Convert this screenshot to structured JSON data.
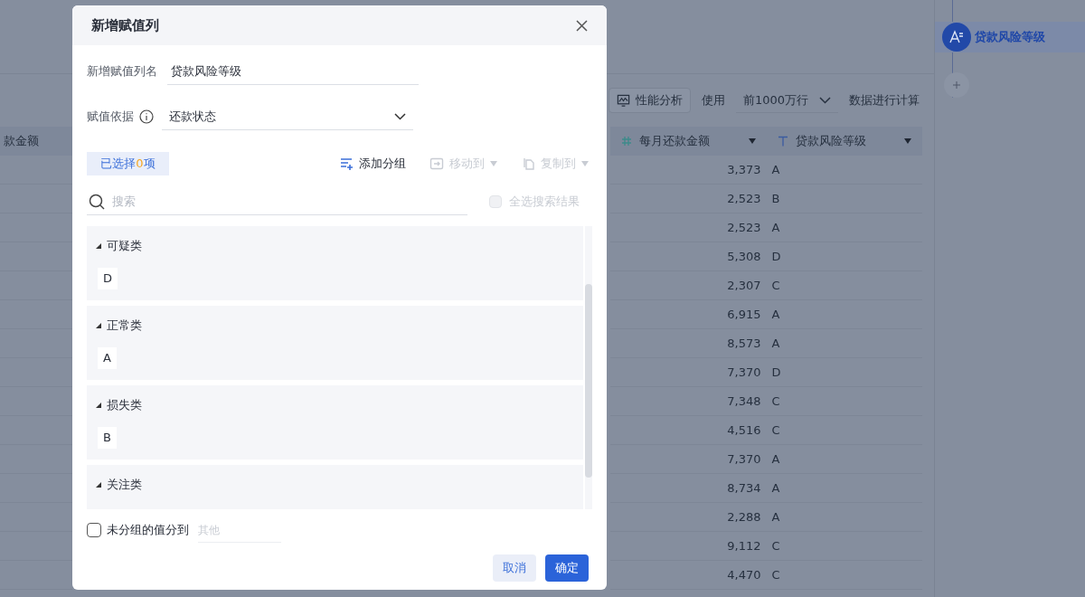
{
  "background": {
    "toolbar": {
      "analysis_button": "性能分析",
      "use_label": "使用",
      "rows_select": "前1000万行",
      "compute_label": "数据进行计算"
    },
    "table": {
      "left_column": "款金额",
      "columns": [
        {
          "label": "每月还款金额",
          "kind": "number"
        },
        {
          "label": "贷款风险等级",
          "kind": "text"
        }
      ],
      "rows": [
        [
          "3,373",
          "A"
        ],
        [
          "2,523",
          "B"
        ],
        [
          "2,523",
          "A"
        ],
        [
          "5,308",
          "D"
        ],
        [
          "2,307",
          "C"
        ],
        [
          "6,915",
          "A"
        ],
        [
          "8,573",
          "A"
        ],
        [
          "7,370",
          "D"
        ],
        [
          "7,348",
          "C"
        ],
        [
          "4,516",
          "C"
        ],
        [
          "7,370",
          "A"
        ],
        [
          "8,734",
          "A"
        ],
        [
          "2,288",
          "A"
        ],
        [
          "9,112",
          "C"
        ],
        [
          "4,470",
          "C"
        ]
      ]
    },
    "flow": {
      "node_label": "贷款风险等级",
      "selected": true
    }
  },
  "dialog": {
    "title": "新增赋值列",
    "name_label": "新增赋值列名",
    "name_value": "贷款风险等级",
    "basis_label": "赋值依据",
    "basis_value": "还款状态",
    "selected_prefix": "已选择",
    "selected_count": "0",
    "selected_suffix": "项",
    "actions": [
      {
        "label": "添加分组",
        "kind": "add",
        "disabled": false
      },
      {
        "label": "移动到",
        "kind": "move",
        "disabled": true
      },
      {
        "label": "复制到",
        "kind": "copy",
        "disabled": true
      }
    ],
    "search": {
      "placeholder": "搜索"
    },
    "select_all": {
      "label": "全选搜索结果",
      "checked": false,
      "disabled": true
    },
    "groups": [
      {
        "name": "可疑类",
        "expanded": true,
        "items": [
          "D"
        ]
      },
      {
        "name": "正常类",
        "expanded": true,
        "items": [
          "A"
        ]
      },
      {
        "name": "损失类",
        "expanded": true,
        "items": [
          "B"
        ]
      },
      {
        "name": "关注类",
        "expanded": true
      }
    ],
    "ungrouped": {
      "label": "未分组的值分到",
      "checked": false,
      "placeholder": "其他"
    },
    "buttons": [
      {
        "label": "取消",
        "kind": "secondary"
      },
      {
        "label": "确定",
        "kind": "primary"
      }
    ]
  }
}
